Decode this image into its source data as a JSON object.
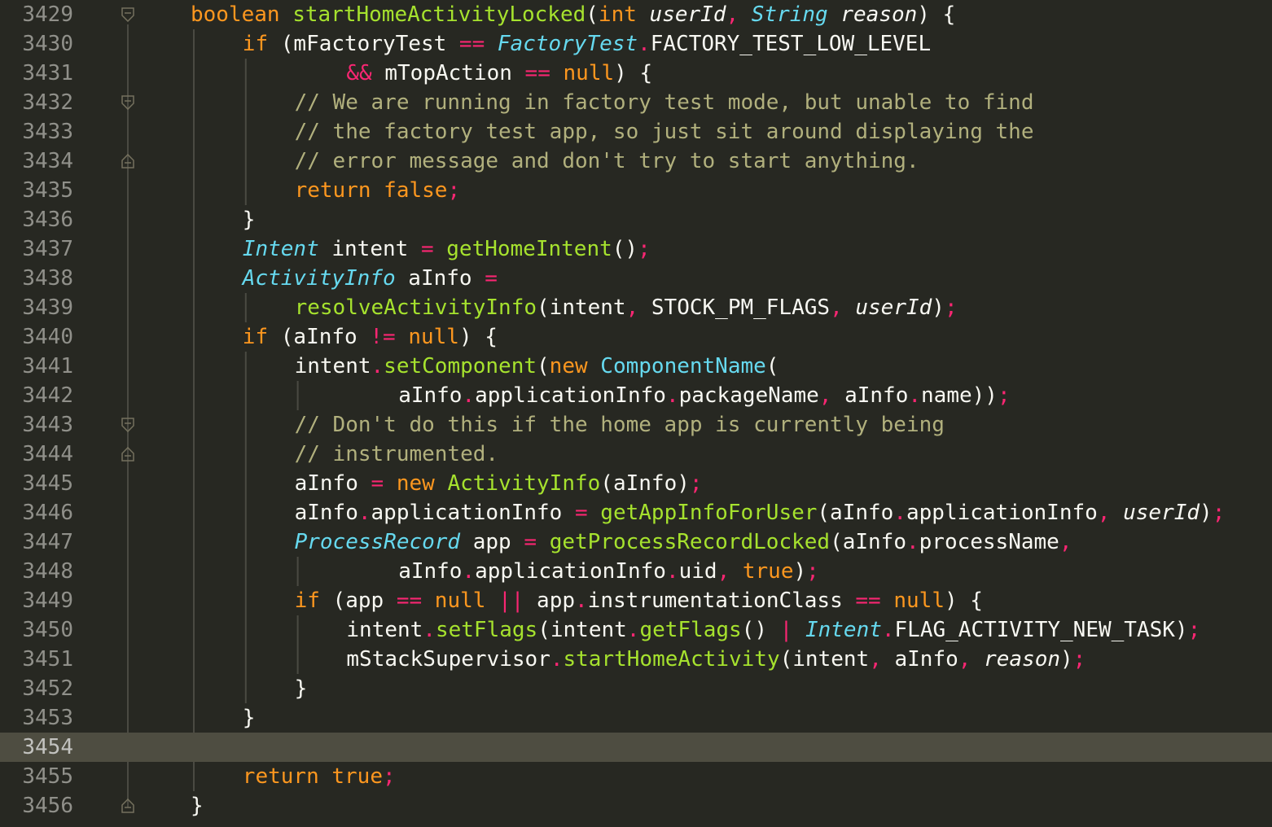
{
  "theme": {
    "background": "#272822",
    "current_line": "#4e4d41",
    "gutter_text": "#90908a",
    "keyword": "#fd971f",
    "operator": "#f92672",
    "type": "#66d9ef",
    "function": "#a6e22e",
    "comment": "#b1b07d",
    "text": "#f8f8f2",
    "punct": "#f92672"
  },
  "current_line_number": "3454",
  "lines": [
    {
      "num": "3429",
      "indent": 3,
      "fold": "open",
      "tokens": [
        {
          "t": "boolean",
          "c": "kw"
        },
        {
          "t": " "
        },
        {
          "t": "startHomeActivityLocked",
          "c": "fn"
        },
        {
          "t": "("
        },
        {
          "t": "int",
          "c": "kw"
        },
        {
          "t": " "
        },
        {
          "t": "userId",
          "c": "param"
        },
        {
          "t": ",",
          "c": "punct"
        },
        {
          "t": " "
        },
        {
          "t": "String",
          "c": "type"
        },
        {
          "t": " "
        },
        {
          "t": "reason",
          "c": "param"
        },
        {
          "t": ")"
        },
        {
          "t": " {"
        }
      ]
    },
    {
      "num": "3430",
      "indent": 4,
      "fold": "",
      "tokens": [
        {
          "t": "if",
          "c": "kw"
        },
        {
          "t": " (mFactoryTest "
        },
        {
          "t": "==",
          "c": "op"
        },
        {
          "t": " "
        },
        {
          "t": "FactoryTest",
          "c": "type"
        },
        {
          "t": ".",
          "c": "punct"
        },
        {
          "t": "FACTORY_TEST_LOW_LEVEL"
        }
      ]
    },
    {
      "num": "3431",
      "indent": 6,
      "fold": "",
      "tokens": [
        {
          "t": "&&",
          "c": "op"
        },
        {
          "t": " mTopAction "
        },
        {
          "t": "==",
          "c": "op"
        },
        {
          "t": " "
        },
        {
          "t": "null",
          "c": "kw"
        },
        {
          "t": ") {"
        }
      ]
    },
    {
      "num": "3432",
      "indent": 5,
      "fold": "open",
      "tokens": [
        {
          "t": "// We are running in factory test mode, but unable to find",
          "c": "cm"
        }
      ]
    },
    {
      "num": "3433",
      "indent": 5,
      "fold": "",
      "tokens": [
        {
          "t": "// the factory test app, so just sit around displaying the",
          "c": "cm"
        }
      ]
    },
    {
      "num": "3434",
      "indent": 5,
      "fold": "close",
      "tokens": [
        {
          "t": "// error message and don't try to start anything.",
          "c": "cm"
        }
      ]
    },
    {
      "num": "3435",
      "indent": 5,
      "fold": "",
      "tokens": [
        {
          "t": "return",
          "c": "kw"
        },
        {
          "t": " "
        },
        {
          "t": "false",
          "c": "kw"
        },
        {
          "t": ";",
          "c": "punct"
        }
      ]
    },
    {
      "num": "3436",
      "indent": 4,
      "fold": "",
      "tokens": [
        {
          "t": "}"
        }
      ]
    },
    {
      "num": "3437",
      "indent": 4,
      "fold": "",
      "tokens": [
        {
          "t": "Intent",
          "c": "type"
        },
        {
          "t": " intent "
        },
        {
          "t": "=",
          "c": "op"
        },
        {
          "t": " "
        },
        {
          "t": "getHomeIntent",
          "c": "fn"
        },
        {
          "t": "()"
        },
        {
          "t": ";",
          "c": "punct"
        }
      ]
    },
    {
      "num": "3438",
      "indent": 4,
      "fold": "",
      "tokens": [
        {
          "t": "ActivityInfo",
          "c": "type"
        },
        {
          "t": " aInfo "
        },
        {
          "t": "=",
          "c": "op"
        }
      ]
    },
    {
      "num": "3439",
      "indent": 5,
      "fold": "",
      "tokens": [
        {
          "t": "resolveActivityInfo",
          "c": "fn"
        },
        {
          "t": "(intent"
        },
        {
          "t": ",",
          "c": "punct"
        },
        {
          "t": " STOCK_PM_FLAGS"
        },
        {
          "t": ",",
          "c": "punct"
        },
        {
          "t": " "
        },
        {
          "t": "userId",
          "c": "param"
        },
        {
          "t": ")"
        },
        {
          "t": ";",
          "c": "punct"
        }
      ]
    },
    {
      "num": "3440",
      "indent": 4,
      "fold": "",
      "tokens": [
        {
          "t": "if",
          "c": "kw"
        },
        {
          "t": " (aInfo "
        },
        {
          "t": "!=",
          "c": "op"
        },
        {
          "t": " "
        },
        {
          "t": "null",
          "c": "kw"
        },
        {
          "t": ") {"
        }
      ]
    },
    {
      "num": "3441",
      "indent": 5,
      "fold": "",
      "tokens": [
        {
          "t": "intent"
        },
        {
          "t": ".",
          "c": "punct"
        },
        {
          "t": "setComponent",
          "c": "fn"
        },
        {
          "t": "("
        },
        {
          "t": "new",
          "c": "kw"
        },
        {
          "t": " "
        },
        {
          "t": "ComponentName",
          "c": "typeN"
        },
        {
          "t": "("
        }
      ]
    },
    {
      "num": "3442",
      "indent": 7,
      "fold": "",
      "tokens": [
        {
          "t": "aInfo"
        },
        {
          "t": ".",
          "c": "punct"
        },
        {
          "t": "applicationInfo"
        },
        {
          "t": ".",
          "c": "punct"
        },
        {
          "t": "packageName"
        },
        {
          "t": ",",
          "c": "punct"
        },
        {
          "t": " aInfo"
        },
        {
          "t": ".",
          "c": "punct"
        },
        {
          "t": "name))"
        },
        {
          "t": ";",
          "c": "punct"
        }
      ]
    },
    {
      "num": "3443",
      "indent": 5,
      "fold": "open",
      "tokens": [
        {
          "t": "// Don't do this if the home app is currently being",
          "c": "cm"
        }
      ]
    },
    {
      "num": "3444",
      "indent": 5,
      "fold": "close",
      "tokens": [
        {
          "t": "// instrumented.",
          "c": "cm"
        }
      ]
    },
    {
      "num": "3445",
      "indent": 5,
      "fold": "",
      "tokens": [
        {
          "t": "aInfo "
        },
        {
          "t": "=",
          "c": "op"
        },
        {
          "t": " "
        },
        {
          "t": "new",
          "c": "kw"
        },
        {
          "t": " "
        },
        {
          "t": "ActivityInfo",
          "c": "fnT"
        },
        {
          "t": "(aInfo)"
        },
        {
          "t": ";",
          "c": "punct"
        }
      ]
    },
    {
      "num": "3446",
      "indent": 5,
      "fold": "",
      "tokens": [
        {
          "t": "aInfo"
        },
        {
          "t": ".",
          "c": "punct"
        },
        {
          "t": "applicationInfo "
        },
        {
          "t": "=",
          "c": "op"
        },
        {
          "t": " "
        },
        {
          "t": "getAppInfoForUser",
          "c": "fn"
        },
        {
          "t": "(aInfo"
        },
        {
          "t": ".",
          "c": "punct"
        },
        {
          "t": "applicationInfo"
        },
        {
          "t": ",",
          "c": "punct"
        },
        {
          "t": " "
        },
        {
          "t": "userId",
          "c": "param"
        },
        {
          "t": ")"
        },
        {
          "t": ";",
          "c": "punct"
        }
      ]
    },
    {
      "num": "3447",
      "indent": 5,
      "fold": "",
      "tokens": [
        {
          "t": "ProcessRecord",
          "c": "type"
        },
        {
          "t": " app "
        },
        {
          "t": "=",
          "c": "op"
        },
        {
          "t": " "
        },
        {
          "t": "getProcessRecordLocked",
          "c": "fn"
        },
        {
          "t": "(aInfo"
        },
        {
          "t": ".",
          "c": "punct"
        },
        {
          "t": "processName"
        },
        {
          "t": ",",
          "c": "punct"
        }
      ]
    },
    {
      "num": "3448",
      "indent": 7,
      "fold": "",
      "tokens": [
        {
          "t": "aInfo"
        },
        {
          "t": ".",
          "c": "punct"
        },
        {
          "t": "applicationInfo"
        },
        {
          "t": ".",
          "c": "punct"
        },
        {
          "t": "uid"
        },
        {
          "t": ",",
          "c": "punct"
        },
        {
          "t": " "
        },
        {
          "t": "true",
          "c": "kw"
        },
        {
          "t": ")"
        },
        {
          "t": ";",
          "c": "punct"
        }
      ]
    },
    {
      "num": "3449",
      "indent": 5,
      "fold": "",
      "tokens": [
        {
          "t": "if",
          "c": "kw"
        },
        {
          "t": " (app "
        },
        {
          "t": "==",
          "c": "op"
        },
        {
          "t": " "
        },
        {
          "t": "null",
          "c": "kw"
        },
        {
          "t": " "
        },
        {
          "t": "||",
          "c": "op"
        },
        {
          "t": " app"
        },
        {
          "t": ".",
          "c": "punct"
        },
        {
          "t": "instrumentationClass "
        },
        {
          "t": "==",
          "c": "op"
        },
        {
          "t": " "
        },
        {
          "t": "null",
          "c": "kw"
        },
        {
          "t": ") {"
        }
      ]
    },
    {
      "num": "3450",
      "indent": 6,
      "fold": "",
      "tokens": [
        {
          "t": "intent"
        },
        {
          "t": ".",
          "c": "punct"
        },
        {
          "t": "setFlags",
          "c": "fn"
        },
        {
          "t": "(intent"
        },
        {
          "t": ".",
          "c": "punct"
        },
        {
          "t": "getFlags",
          "c": "fn"
        },
        {
          "t": "() "
        },
        {
          "t": "|",
          "c": "op"
        },
        {
          "t": " "
        },
        {
          "t": "Intent",
          "c": "type"
        },
        {
          "t": ".",
          "c": "punct"
        },
        {
          "t": "FLAG_ACTIVITY_NEW_TASK)"
        },
        {
          "t": ";",
          "c": "punct"
        }
      ]
    },
    {
      "num": "3451",
      "indent": 6,
      "fold": "",
      "tokens": [
        {
          "t": "mStackSupervisor"
        },
        {
          "t": ".",
          "c": "punct"
        },
        {
          "t": "startHomeActivity",
          "c": "fn"
        },
        {
          "t": "(intent"
        },
        {
          "t": ",",
          "c": "punct"
        },
        {
          "t": " aInfo"
        },
        {
          "t": ",",
          "c": "punct"
        },
        {
          "t": " "
        },
        {
          "t": "reason",
          "c": "param"
        },
        {
          "t": ")"
        },
        {
          "t": ";",
          "c": "punct"
        }
      ]
    },
    {
      "num": "3452",
      "indent": 5,
      "fold": "",
      "tokens": [
        {
          "t": "}"
        }
      ]
    },
    {
      "num": "3453",
      "indent": 4,
      "fold": "",
      "tokens": [
        {
          "t": "}"
        }
      ]
    },
    {
      "num": "3454",
      "indent": 4,
      "fold": "",
      "tokens": []
    },
    {
      "num": "3455",
      "indent": 4,
      "fold": "",
      "tokens": [
        {
          "t": "return",
          "c": "kw"
        },
        {
          "t": " "
        },
        {
          "t": "true",
          "c": "kw"
        },
        {
          "t": ";",
          "c": "punct"
        }
      ]
    },
    {
      "num": "3456",
      "indent": 3,
      "fold": "close",
      "tokens": [
        {
          "t": "}"
        }
      ]
    }
  ]
}
